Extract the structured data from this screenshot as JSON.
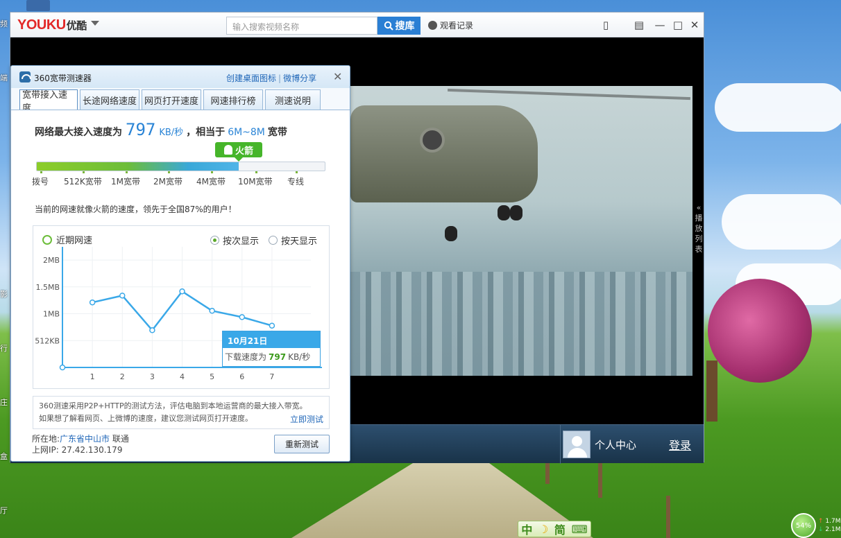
{
  "desktop": {
    "left_labels": [
      "频",
      "端",
      "影",
      "行",
      "庄",
      "盒",
      "厅"
    ]
  },
  "youku": {
    "logo": "YOUKU",
    "logo_cn": "优酷",
    "search_placeholder": "输入搜索视频名称",
    "search_button": "搜库",
    "history_label": "观看记录",
    "playlist_tab": "« 播 放 列 表",
    "user_center": "个人中心",
    "login": "登录"
  },
  "speedtest": {
    "title": "360宽带测速器",
    "link_desktop_icon": "创建桌面图标",
    "link_share": "微博分享",
    "tabs": [
      "宽带接入速度",
      "长途网络速度",
      "网页打开速度",
      "网速排行榜",
      "测速说明"
    ],
    "active_tab": 0,
    "headline_prefix": "网络最大接入速度为",
    "speed_value": "797",
    "speed_unit": "KB/秒",
    "headline_mid": "，相当于",
    "band_equiv": "6M~8M",
    "headline_suffix": "宽带",
    "level_badge": "火箭",
    "level_fraction": 0.7,
    "scale_labels": [
      "拨号",
      "512K宽带",
      "1M宽带",
      "2M宽带",
      "4M宽带",
      "10M宽带",
      "专线"
    ],
    "description": "当前的网速就像火箭的速度，领先于全国87%的用户！",
    "recent_title": "近期网速",
    "radio_by_test": "按次显示",
    "radio_by_day": "按天显示",
    "tooltip_date": "10月21日",
    "tooltip_prefix": "下载速度为",
    "tooltip_value": "797",
    "tooltip_unit": "KB/秒",
    "note_line1": "360测速采用P2P+HTTP的测试方法，评估电脑到本地运营商的最大接入带宽。",
    "note_line2": "如果想了解看网页、上微博的速度，建议您测试网页打开速度。",
    "note_link": "立即测试",
    "location_label": "所在地:",
    "location_city": "广东省中山市",
    "location_isp": "联通",
    "ip_label": "上网IP:",
    "ip_value": "27.42.130.179",
    "retest_button": "重新测试"
  },
  "chart_data": {
    "type": "line",
    "x": [
      1,
      2,
      3,
      4,
      5,
      6,
      7
    ],
    "y_ticks": [
      "512KB",
      "1MB",
      "1.5MB",
      "2MB"
    ],
    "y_tick_values": [
      512,
      1024,
      1536,
      2048
    ],
    "series": [
      {
        "values": [
          1240,
          1370,
          710,
          1450,
          1080,
          960,
          797
        ]
      }
    ],
    "ylim": [
      0,
      2300
    ],
    "grid": true,
    "line_color": "#3aa8e8"
  },
  "ime": {
    "lang": "中",
    "mode": "简"
  },
  "netmon": {
    "percent": "54%",
    "up": "1.7M",
    "down": "2.1M"
  }
}
